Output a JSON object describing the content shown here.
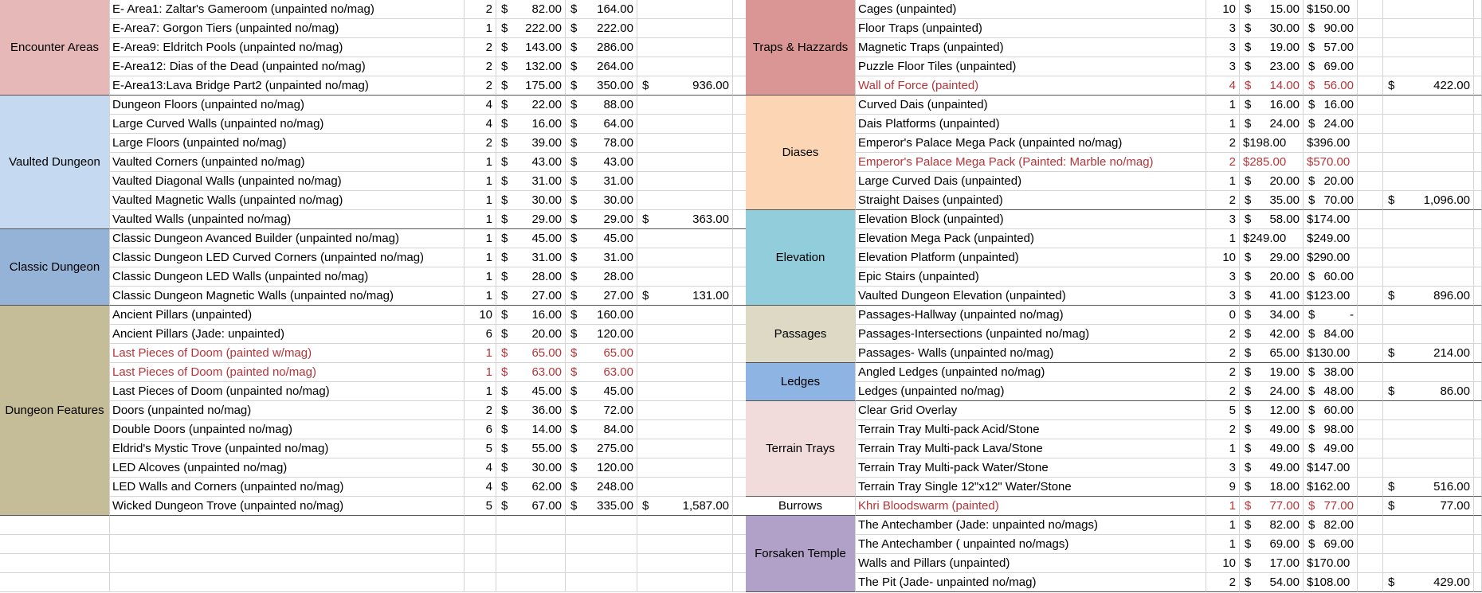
{
  "left": {
    "groups": [
      {
        "category": "Encounter Areas",
        "color": "#e6b9b8",
        "total": "936.00",
        "items": [
          {
            "name": "E- Area1: Zaltar's Gameroom (unpainted no/mag)",
            "qty": "2",
            "price": "82.00",
            "ext": "164.00"
          },
          {
            "name": "E-Area7: Gorgon Tiers (unpainted no/mag)",
            "qty": "1",
            "price": "222.00",
            "ext": "222.00"
          },
          {
            "name": "E-Area9: Eldritch Pools (unpainted no/mag)",
            "qty": "2",
            "price": "143.00",
            "ext": "286.00"
          },
          {
            "name": "E-Area12: Dias of the Dead (unpainted no/mag)",
            "qty": "2",
            "price": "132.00",
            "ext": "264.00"
          },
          {
            "name": "E-Area13:Lava Bridge Part2 (unpainted no/mag)",
            "qty": "2",
            "price": "175.00",
            "ext": "350.00"
          }
        ]
      },
      {
        "category": "Vaulted Dungeon",
        "color": "#c5d9f1",
        "total": "363.00",
        "items": [
          {
            "name": "Dungeon Floors (unpainted no/mag)",
            "qty": "4",
            "price": "22.00",
            "ext": "88.00"
          },
          {
            "name": "Large Curved Walls (unpainted no/mag)",
            "qty": "4",
            "price": "16.00",
            "ext": "64.00"
          },
          {
            "name": "Large Floors (unpainted no/mag)",
            "qty": "2",
            "price": "39.00",
            "ext": "78.00"
          },
          {
            "name": "Vaulted Corners (unpainted no/mag)",
            "qty": "1",
            "price": "43.00",
            "ext": "43.00"
          },
          {
            "name": "Vaulted Diagonal Walls (unpainted no/mag)",
            "qty": "1",
            "price": "31.00",
            "ext": "31.00"
          },
          {
            "name": "Vaulted Magnetic Walls (unpainted no/mag)",
            "qty": "1",
            "price": "30.00",
            "ext": "30.00"
          },
          {
            "name": "Vaulted Walls (unpainted no/mag)",
            "qty": "1",
            "price": "29.00",
            "ext": "29.00"
          }
        ]
      },
      {
        "category": "Classic Dungeon",
        "color": "#95b3d7",
        "total": "131.00",
        "items": [
          {
            "name": "Classic Dungeon Avanced Builder  (unpainted no/mag)",
            "qty": "1",
            "price": "45.00",
            "ext": "45.00"
          },
          {
            "name": "Classic Dungeon LED Curved Corners  (unpainted no/mag)",
            "qty": "1",
            "price": "31.00",
            "ext": "31.00"
          },
          {
            "name": "Classic Dungeon LED Walls  (unpainted no/mag)",
            "qty": "1",
            "price": "28.00",
            "ext": "28.00"
          },
          {
            "name": "Classic Dungeon Magnetic Walls (unpainted no/mag)",
            "qty": "1",
            "price": "27.00",
            "ext": "27.00"
          }
        ]
      },
      {
        "category": "Dungeon Features",
        "color": "#c4bd97",
        "total": "1,587.00",
        "items": [
          {
            "name": "Ancient Pillars (unpainted)",
            "qty": "10",
            "price": "16.00",
            "ext": "160.00"
          },
          {
            "name": "Ancient Pillars (Jade: unpainted)",
            "qty": "6",
            "price": "20.00",
            "ext": "120.00"
          },
          {
            "name": "Last Pieces of Doom (painted w/mag)",
            "qty": "1",
            "price": "65.00",
            "ext": "65.00",
            "red": true
          },
          {
            "name": "Last Pieces of Doom (painted no/mag)",
            "qty": "1",
            "price": "63.00",
            "ext": "63.00",
            "red": true
          },
          {
            "name": "Last Pieces of Doom (unpainted no/mag)",
            "qty": "1",
            "price": "45.00",
            "ext": "45.00"
          },
          {
            "name": "Doors (unpainted no/mag)",
            "qty": "2",
            "price": "36.00",
            "ext": "72.00"
          },
          {
            "name": "Double Doors  (unpainted no/mag)",
            "qty": "6",
            "price": "14.00",
            "ext": "84.00"
          },
          {
            "name": "Eldrid's Mystic Trove  (unpainted no/mag)",
            "qty": "5",
            "price": "55.00",
            "ext": "275.00"
          },
          {
            "name": "LED Alcoves  (unpainted no/mag)",
            "qty": "4",
            "price": "30.00",
            "ext": "120.00"
          },
          {
            "name": "LED Walls and Corners  (unpainted no/mag)",
            "qty": "4",
            "price": "62.00",
            "ext": "248.00"
          },
          {
            "name": "Wicked Dungeon Trove  (unpainted no/mag)",
            "qty": "5",
            "price": "67.00",
            "ext": "335.00"
          }
        ]
      }
    ]
  },
  "right": {
    "groups": [
      {
        "category": "Traps & Hazzards",
        "color": "#da9694",
        "total": "422.00",
        "items": [
          {
            "name": "Cages  (unpainted)",
            "qty": "10",
            "price": "15.00",
            "ext": "$150.00"
          },
          {
            "name": "Floor Traps (unpainted)",
            "qty": "3",
            "price": "30.00",
            "ext": "90.00"
          },
          {
            "name": "Magnetic Traps (unpainted)",
            "qty": "3",
            "price": "19.00",
            "ext": "57.00"
          },
          {
            "name": "Puzzle Floor Tiles (unpainted)",
            "qty": "3",
            "price": "23.00",
            "ext": "69.00"
          },
          {
            "name": "Wall of Force (painted)",
            "qty": "4",
            "price": "14.00",
            "ext": "56.00",
            "red": true
          }
        ]
      },
      {
        "category": "Diases",
        "color": "#fcd5b4",
        "total": "1,096.00",
        "items": [
          {
            "name": "Curved Dais  (unpainted)",
            "qty": "1",
            "price": "16.00",
            "ext": "16.00"
          },
          {
            "name": "Dais Platforms  (unpainted)",
            "qty": "1",
            "price": "24.00",
            "ext": "24.00"
          },
          {
            "name": "Emperor's Palace Mega Pack (unpainted no/mag)",
            "qty": "2",
            "price": "$198.00",
            "ext": "$396.00"
          },
          {
            "name": "Emperor's Palace Mega Pack (Painted: Marble no/mag)",
            "qty": "2",
            "price": "$285.00",
            "ext": "$570.00",
            "red": true
          },
          {
            "name": "Large Curved Dais  (unpainted)",
            "qty": "1",
            "price": "20.00",
            "ext": "20.00"
          },
          {
            "name": "Straight Daises  (unpainted)",
            "qty": "2",
            "price": "35.00",
            "ext": "70.00"
          }
        ]
      },
      {
        "category": "Elevation",
        "color": "#92cddc",
        "total": "896.00",
        "items": [
          {
            "name": "Elevation Block (unpainted)",
            "qty": "3",
            "price": "58.00",
            "ext": "$174.00"
          },
          {
            "name": "Elevation Mega Pack (unpainted)",
            "qty": "1",
            "price": "$249.00",
            "ext": "$249.00"
          },
          {
            "name": "Elevation Platform (unpainted)",
            "qty": "10",
            "price": "29.00",
            "ext": "$290.00"
          },
          {
            "name": "Epic Stairs (unpainted)",
            "qty": "3",
            "price": "20.00",
            "ext": "60.00"
          },
          {
            "name": "Vaulted Dungeon Elevation (unpainted)",
            "qty": "3",
            "price": "41.00",
            "ext": "$123.00"
          }
        ]
      },
      {
        "category": "Passages",
        "color": "#ddd9c4",
        "total": "214.00",
        "items": [
          {
            "name": "Passages-Hallway (unpainted no/mag)",
            "qty": "0",
            "price": "34.00",
            "ext": "-"
          },
          {
            "name": "Passages-Intersections (unpainted no/mag)",
            "qty": "2",
            "price": "42.00",
            "ext": "84.00"
          },
          {
            "name": "Passages- Walls (unpainted no/mag)",
            "qty": "2",
            "price": "65.00",
            "ext": "$130.00"
          }
        ]
      },
      {
        "category": "Ledges",
        "color": "#8db4e2",
        "total": "86.00",
        "items": [
          {
            "name": "Angled Ledges (unpainted no/mag)",
            "qty": "2",
            "price": "19.00",
            "ext": "38.00"
          },
          {
            "name": "Ledges (unpainted no/mag)",
            "qty": "2",
            "price": "24.00",
            "ext": "48.00"
          }
        ]
      },
      {
        "category": "Terrain Trays",
        "color": "#f2dcdb",
        "total": "516.00",
        "items": [
          {
            "name": "Clear Grid Overlay",
            "qty": "5",
            "price": "12.00",
            "ext": "60.00"
          },
          {
            "name": "Terrain Tray Multi-pack Acid/Stone",
            "qty": "2",
            "price": "49.00",
            "ext": "98.00"
          },
          {
            "name": "Terrain Tray Multi-pack Lava/Stone",
            "qty": "1",
            "price": "49.00",
            "ext": "49.00"
          },
          {
            "name": "Terrain Tray Multi-pack Water/Stone",
            "qty": "3",
            "price": "49.00",
            "ext": "$147.00"
          },
          {
            "name": "Terrain Tray Single 12\"x12\" Water/Stone",
            "qty": "9",
            "price": "18.00",
            "ext": "$162.00"
          }
        ]
      },
      {
        "category": "Burrows",
        "color": "#ffffff",
        "total": "77.00",
        "items": [
          {
            "name": "Khri Bloodswarm (painted)",
            "qty": "1",
            "price": "77.00",
            "ext": "77.00",
            "red": true
          }
        ]
      },
      {
        "category": "Forsaken Temple",
        "color": "#b1a0c7",
        "total": "429.00",
        "items": [
          {
            "name": "The Antechamber (Jade: unpainted no/mags)",
            "qty": "1",
            "price": "82.00",
            "ext": "82.00"
          },
          {
            "name": "The Antechamber ( unpainted no/mags)",
            "qty": "1",
            "price": "69.00",
            "ext": "69.00"
          },
          {
            "name": "Walls and Pillars (unpainted)",
            "qty": "10",
            "price": "17.00",
            "ext": "$170.00"
          },
          {
            "name": "The Pit (Jade- unpainted no/mag)",
            "qty": "2",
            "price": "54.00",
            "ext": "$108.00"
          }
        ]
      }
    ]
  },
  "currency_symbol": "$"
}
